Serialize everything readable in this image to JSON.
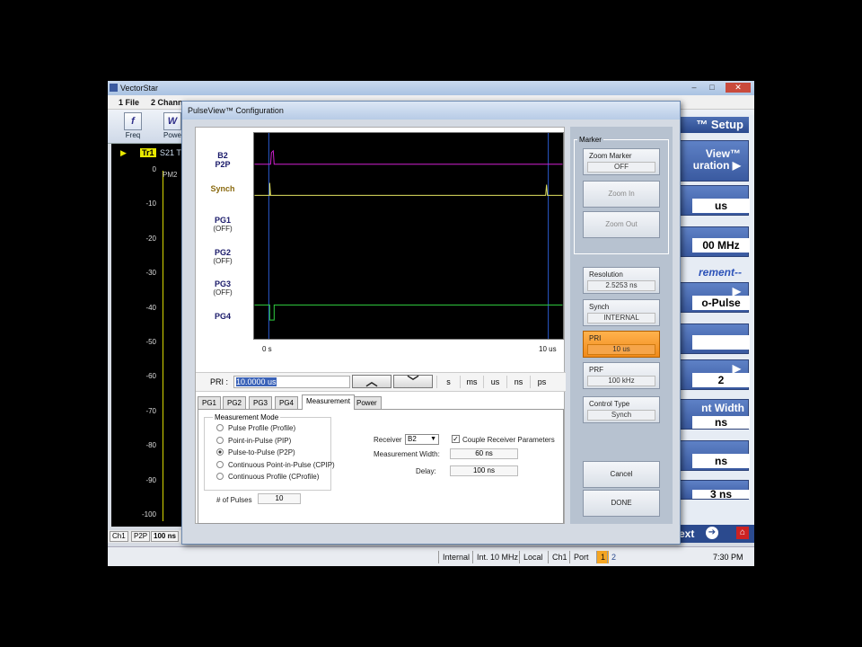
{
  "app": {
    "title": "VectorStar",
    "menu": [
      "1 File",
      "2 Chann"
    ],
    "toolbar": [
      {
        "label": "Freq",
        "icon": "f"
      },
      {
        "label": "Powe",
        "icon": "W"
      }
    ],
    "trace": {
      "tag": "Tr1",
      "name": "S21 Tra"
    },
    "plot_pm2": "PM2",
    "yticks": [
      "0",
      "-10",
      "-20",
      "-30",
      "-40",
      "-50",
      "-60",
      "-70",
      "-80",
      "-90",
      "-100"
    ],
    "status": [
      "Ch1",
      "P2P",
      "100 ns"
    ],
    "setup": {
      "title": "™ Setup",
      "items": [
        {
          "label": "View™\nuration"
        },
        {
          "value": "us"
        },
        {
          "value": "00 MHz"
        },
        {
          "label": "rement--"
        },
        {
          "value": "o-Pulse"
        },
        {
          "value": "2"
        },
        {
          "label": "nt Width"
        },
        {
          "value": "ns"
        },
        {
          "value": "ns"
        },
        {
          "value": "3 ns"
        }
      ],
      "next": "ext"
    },
    "taskbar": [
      "Internal",
      "Int. 10 MHz",
      "Local",
      "Ch1",
      "Port",
      "1",
      "2"
    ],
    "time": "7:30 PM"
  },
  "dialog": {
    "title": "PulseView™ Configuration",
    "channels": [
      {
        "name": "B2",
        "sub": "P2P"
      },
      {
        "name": "Synch",
        "sub": ""
      },
      {
        "name": "PG1",
        "sub": "(OFF)"
      },
      {
        "name": "PG2",
        "sub": "(OFF)"
      },
      {
        "name": "PG3",
        "sub": "(OFF)"
      },
      {
        "name": "PG4",
        "sub": ""
      }
    ],
    "x_start": "0 s",
    "x_end": "10 us",
    "pri_label": "PRI :",
    "pri_value": "10.0000 us",
    "units": [
      "s",
      "ms",
      "us",
      "ns",
      "ps"
    ],
    "tabs": [
      "PG1",
      "PG2",
      "PG3",
      "PG4",
      "Measurement",
      "Power"
    ],
    "active_tab": "Measurement",
    "measurement_mode": {
      "title": "Measurement Mode",
      "options": [
        "Pulse Profile (Profile)",
        "Point-in-Pulse (PIP)",
        "Pulse-to-Pulse (P2P)",
        "Continuous Point-in-Pulse (CPIP)",
        "Continuous Profile (CProfile)"
      ],
      "selected_index": 2
    },
    "num_pulses_label": "# of Pulses",
    "num_pulses": "10",
    "receiver_label": "Receiver",
    "receiver": "B2",
    "couple_label": "Couple Receiver Parameters",
    "couple_checked": true,
    "meas_width_label": "Measurement Width:",
    "meas_width": "60 ns",
    "delay_label": "Delay:",
    "delay": "100 ns",
    "marker_group": "Marker",
    "zoom_marker": {
      "title": "Zoom Marker",
      "value": "OFF"
    },
    "zoom_in": "Zoom In",
    "zoom_out": "Zoom Out",
    "resolution": {
      "title": "Resolution",
      "value": "2.5253 ns"
    },
    "synch": {
      "title": "Synch",
      "value": "INTERNAL"
    },
    "pri": {
      "title": "PRI",
      "value": "10 us"
    },
    "prf": {
      "title": "PRF",
      "value": "100 kHz"
    },
    "control_type": {
      "title": "Control Type",
      "value": "Synch"
    },
    "cancel": "Cancel",
    "done": "DONE"
  },
  "colors": {
    "b2_trace": "#d020d0",
    "synch_trace": "#e0e060",
    "pg4_trace": "#30d040",
    "marker_line": "#2a5cd0",
    "active_orange": "#f08a1a"
  }
}
